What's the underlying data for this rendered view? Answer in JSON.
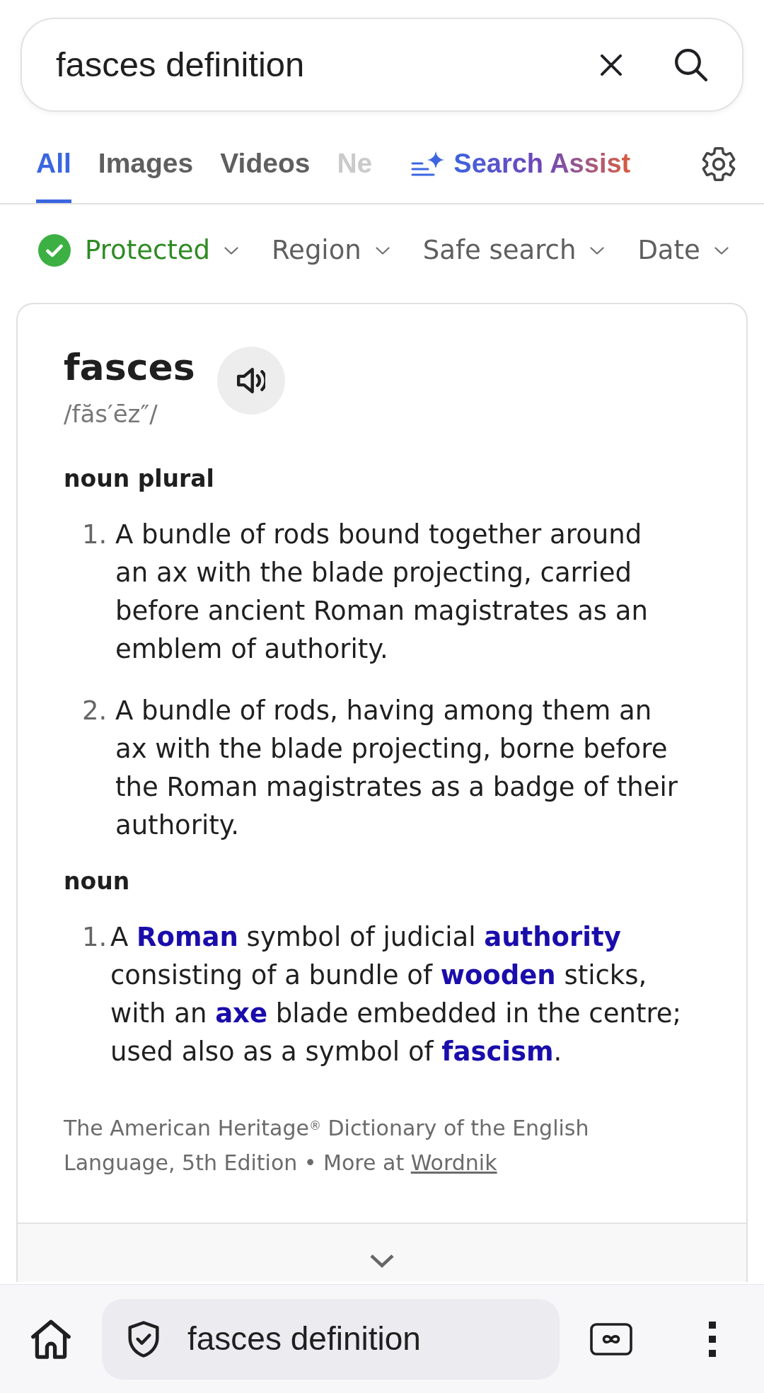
{
  "search": {
    "query": "fasces definition"
  },
  "tabs": [
    {
      "label": "All",
      "selected": true
    },
    {
      "label": "Images",
      "selected": false
    },
    {
      "label": "Videos",
      "selected": false
    },
    {
      "label": "Ne",
      "selected": false
    }
  ],
  "search_assist": {
    "label": "Search Assist"
  },
  "filters": [
    {
      "kind": "status",
      "label": "Protected"
    },
    {
      "kind": "dropdown",
      "label": "Region"
    },
    {
      "kind": "dropdown",
      "label": "Safe search"
    },
    {
      "kind": "dropdown",
      "label": "Date"
    }
  ],
  "definition_card": {
    "word": "fasces",
    "pronunciation": "/făs′ēz″/",
    "sections": [
      {
        "part_of_speech": "noun plural",
        "definitions": [
          {
            "number": "1.",
            "text": "A bundle of rods bound together around an ax with the blade projecting, carried before ancient Roman magistrates as an emblem of authority."
          },
          {
            "number": "2.",
            "text": "A bundle of rods, having among them an ax with the blade projecting, borne before the Roman magistrates as a badge of their authority."
          }
        ]
      },
      {
        "part_of_speech": "noun",
        "definitions": [
          {
            "number": "1.",
            "text": "A **Roman** symbol of judicial **authority** consisting of a bundle of **wooden** sticks, with an **axe** blade embedded in the centre; used also as a symbol of **fascism**."
          }
        ]
      }
    ],
    "attribution": "The American Heritage$^{®}$ Dictionary of the English Language, 5th Edition • More at",
    "attribution_link": "Wordnik"
  },
  "address_bar": {
    "text": "fasces definition"
  }
}
